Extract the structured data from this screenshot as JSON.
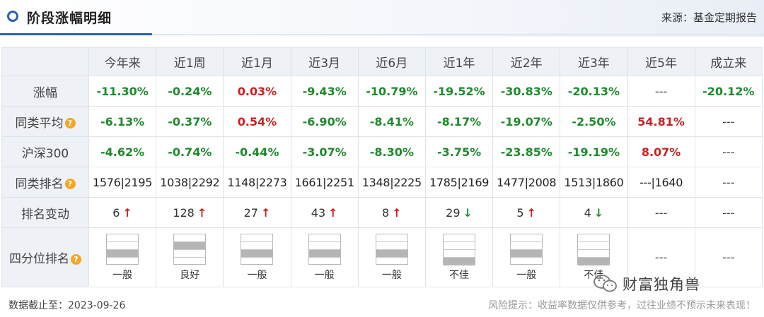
{
  "header": {
    "title": "阶段涨幅明细",
    "source": "来源：基金定期报告"
  },
  "columns": [
    "今年来",
    "近1周",
    "近1月",
    "近3月",
    "近6月",
    "近1年",
    "近2年",
    "近3年",
    "近5年",
    "成立来"
  ],
  "rows": {
    "return": {
      "label": "涨幅",
      "values": [
        "-11.30%",
        "-0.24%",
        "0.03%",
        "-9.43%",
        "-10.79%",
        "-19.52%",
        "-30.83%",
        "-20.13%",
        "---",
        "-20.12%"
      ],
      "colors": [
        "green",
        "green",
        "red",
        "green",
        "green",
        "green",
        "green",
        "green",
        "dash",
        "green"
      ]
    },
    "peer_avg": {
      "label": "同类平均",
      "values": [
        "-6.13%",
        "-0.37%",
        "0.54%",
        "-6.90%",
        "-8.41%",
        "-8.17%",
        "-19.07%",
        "-2.50%",
        "54.81%",
        "---"
      ],
      "colors": [
        "green",
        "green",
        "red",
        "green",
        "green",
        "green",
        "green",
        "green",
        "red",
        "dash"
      ]
    },
    "hs300": {
      "label": "沪深300",
      "values": [
        "-4.62%",
        "-0.74%",
        "-0.44%",
        "-3.07%",
        "-8.30%",
        "-3.75%",
        "-23.85%",
        "-19.19%",
        "8.07%",
        "---"
      ],
      "colors": [
        "green",
        "green",
        "green",
        "green",
        "green",
        "green",
        "green",
        "green",
        "red",
        "dash"
      ]
    },
    "peer_rank": {
      "label": "同类排名",
      "values": [
        "1576|2195",
        "1038|2292",
        "1148|2273",
        "1661|2251",
        "1348|2225",
        "1785|2169",
        "1477|2008",
        "1513|1860",
        "---|1640",
        "---"
      ]
    },
    "rank_change": {
      "label": "排名变动",
      "values": [
        "6",
        "128",
        "27",
        "43",
        "8",
        "29",
        "5",
        "4",
        "---",
        "---"
      ],
      "arrows": [
        "up",
        "up",
        "up",
        "up",
        "up",
        "down",
        "up",
        "down",
        "",
        ""
      ]
    },
    "quartile": {
      "label": "四分位排名",
      "levels": [
        3,
        2,
        3,
        3,
        3,
        4,
        3,
        4,
        0,
        0
      ],
      "labels": [
        "一般",
        "良好",
        "一般",
        "一般",
        "一般",
        "不佳",
        "一般",
        "不佳",
        "---",
        "---"
      ]
    }
  },
  "watermark": {
    "icon": "wechat-icon",
    "text": "财富独角兽"
  },
  "footer": {
    "date": "数据截止至：2023-09-26",
    "risk": "风险提示：收益率数据仅供参考，过往业绩不预示未来表现！"
  },
  "colors": {
    "accent": "#2b63b0",
    "up": "#cc1f1f",
    "down": "#1e8a2b",
    "help": "#f5a623"
  }
}
